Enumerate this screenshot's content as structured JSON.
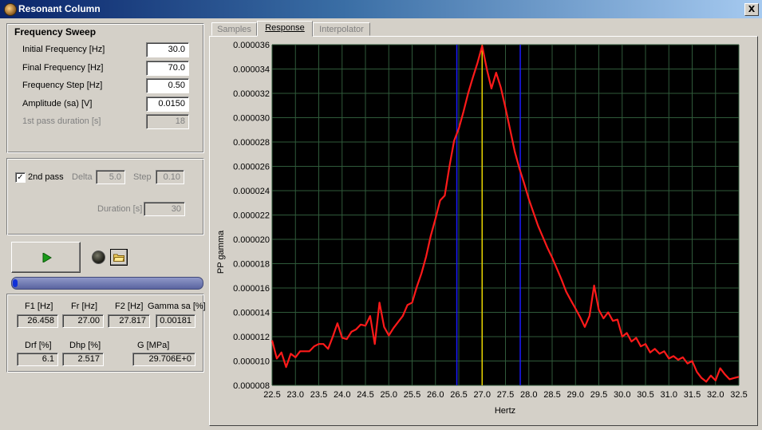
{
  "window": {
    "title": "Resonant Column",
    "close_label": "X"
  },
  "sweep": {
    "title": "Frequency Sweep",
    "initial_label": "Initial Frequency [Hz]",
    "initial_value": "30.0",
    "final_label": "Final Frequency [Hz]",
    "final_value": "70.0",
    "step_label": "Frequency Step  [Hz]",
    "step_value": "0.50",
    "amp_label": "Amplitude (sa) [V]",
    "amp_value": "0.0150",
    "dur_label": "1st pass duration [s]",
    "dur_value": "18"
  },
  "second_pass": {
    "check_label": "2nd pass",
    "checked": true,
    "delta_label": "Delta",
    "delta_value": "5.0",
    "step_label": "Step",
    "step_value": "0.10",
    "dur_label": "Duration [s]",
    "dur_value": "30"
  },
  "progress": {
    "fraction": 0.01
  },
  "results": {
    "f1_label": "F1 [Hz]",
    "f1_value": "26.458",
    "fr_label": "Fr [Hz]",
    "fr_value": "27.00",
    "f2_label": "F2 [Hz]",
    "f2_value": "27.817",
    "gamma_label": "Gamma sa [%]",
    "gamma_value": "0.00181",
    "drf_label": "Drf [%]",
    "drf_value": "6.1",
    "dhp_label": "Dhp [%]",
    "dhp_value": "2.517",
    "g_label": "G [MPa]",
    "g_value": "29.706E+0"
  },
  "tabs": [
    "Samples",
    "Response",
    "Interpolator"
  ],
  "colors": {
    "plot_bg": "#000000",
    "grid": "#2f5a3a",
    "curve": "#ff1a1a",
    "marker_f1f2": "#1a1aff",
    "marker_fr": "#e8d400"
  },
  "chart_data": {
    "type": "line",
    "xlabel": "Hertz",
    "ylabel": "PP gamma",
    "xlim": [
      22.5,
      32.5
    ],
    "ylim": [
      8e-06,
      3.6e-05
    ],
    "xticks": [
      "22.5",
      "23.0",
      "23.5",
      "24.0",
      "24.5",
      "25.0",
      "25.5",
      "26.0",
      "26.5",
      "27.0",
      "27.5",
      "28.0",
      "28.5",
      "29.0",
      "29.5",
      "30.0",
      "30.5",
      "31.0",
      "31.5",
      "32.0",
      "32.5"
    ],
    "yticks": [
      "0.000008",
      "0.000010",
      "0.000012",
      "0.000014",
      "0.000016",
      "0.000018",
      "0.000020",
      "0.000022",
      "0.000024",
      "0.000026",
      "0.000028",
      "0.000030",
      "0.000032",
      "0.000034",
      "0.000036"
    ],
    "grid": true,
    "markers": {
      "f1": 26.458,
      "fr": 27.0,
      "f2": 27.817
    },
    "x": [
      22.5,
      22.6,
      22.7,
      22.8,
      22.9,
      23.0,
      23.1,
      23.2,
      23.3,
      23.4,
      23.5,
      23.6,
      23.7,
      23.8,
      23.9,
      24.0,
      24.1,
      24.2,
      24.3,
      24.4,
      24.5,
      24.6,
      24.7,
      24.8,
      24.9,
      25.0,
      25.1,
      25.2,
      25.3,
      25.4,
      25.5,
      25.6,
      25.7,
      25.8,
      25.9,
      26.0,
      26.1,
      26.2,
      26.3,
      26.4,
      26.5,
      26.6,
      26.7,
      26.8,
      26.9,
      27.0,
      27.1,
      27.2,
      27.3,
      27.4,
      27.5,
      27.6,
      27.7,
      27.8,
      27.9,
      28.0,
      28.1,
      28.2,
      28.3,
      28.4,
      28.5,
      28.6,
      28.7,
      28.8,
      28.9,
      29.0,
      29.1,
      29.2,
      29.3,
      29.4,
      29.5,
      29.6,
      29.7,
      29.8,
      29.9,
      30.0,
      30.1,
      30.2,
      30.3,
      30.4,
      30.5,
      30.6,
      30.7,
      30.8,
      30.9,
      31.0,
      31.1,
      31.2,
      31.3,
      31.4,
      31.5,
      31.6,
      31.7,
      31.8,
      31.9,
      32.0,
      32.1,
      32.2,
      32.3,
      32.4,
      32.5
    ],
    "y": [
      1.17e-05,
      1.02e-05,
      1.07e-05,
      9.5e-06,
      1.06e-05,
      1.03e-05,
      1.08e-05,
      1.08e-05,
      1.08e-05,
      1.12e-05,
      1.14e-05,
      1.14e-05,
      1.1e-05,
      1.2e-05,
      1.31e-05,
      1.19e-05,
      1.18e-05,
      1.24e-05,
      1.26e-05,
      1.3e-05,
      1.29e-05,
      1.37e-05,
      1.14e-05,
      1.48e-05,
      1.28e-05,
      1.21e-05,
      1.27e-05,
      1.32e-05,
      1.37e-05,
      1.46e-05,
      1.48e-05,
      1.61e-05,
      1.72e-05,
      1.86e-05,
      2.03e-05,
      2.17e-05,
      2.32e-05,
      2.36e-05,
      2.6e-05,
      2.81e-05,
      2.91e-05,
      3.05e-05,
      3.2e-05,
      3.33e-05,
      3.45e-05,
      3.59e-05,
      3.4e-05,
      3.24e-05,
      3.37e-05,
      3.25e-05,
      3.08e-05,
      2.9e-05,
      2.72e-05,
      2.58e-05,
      2.46e-05,
      2.33e-05,
      2.22e-05,
      2.11e-05,
      2.02e-05,
      1.93e-05,
      1.85e-05,
      1.76e-05,
      1.67e-05,
      1.57e-05,
      1.5e-05,
      1.43e-05,
      1.36e-05,
      1.28e-05,
      1.37e-05,
      1.62e-05,
      1.42e-05,
      1.35e-05,
      1.4e-05,
      1.33e-05,
      1.34e-05,
      1.2e-05,
      1.23e-05,
      1.16e-05,
      1.19e-05,
      1.12e-05,
      1.14e-05,
      1.07e-05,
      1.1e-05,
      1.06e-05,
      1.08e-05,
      1.02e-05,
      1.04e-05,
      1.01e-05,
      1.03e-05,
      9.8e-06,
      1e-05,
      9.1e-06,
      8.6e-06,
      8.3e-06,
      8.8e-06,
      8.4e-06,
      9.4e-06,
      8.9e-06,
      8.5e-06,
      8.6e-06,
      8.7e-06
    ]
  }
}
